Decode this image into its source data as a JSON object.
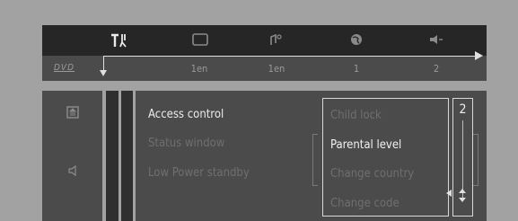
{
  "top_icons": [
    {
      "name": "settings-tools-icon",
      "active": true
    },
    {
      "name": "picture-icon",
      "active": false
    },
    {
      "name": "audio-icon",
      "active": false
    },
    {
      "name": "language-icon",
      "active": false
    },
    {
      "name": "speaker-icon",
      "active": false
    }
  ],
  "info_bar": {
    "disc_label": "DVD",
    "values": [
      "1en",
      "1en",
      "1",
      "2"
    ]
  },
  "side_icons": [
    "disc-icon",
    "speaker-icon"
  ],
  "main_menu": {
    "items": [
      {
        "label": "Access control",
        "active": true
      },
      {
        "label": "Status window",
        "active": false
      },
      {
        "label": "Low Power standby",
        "active": false
      }
    ]
  },
  "submenu": {
    "items": [
      {
        "label": "Child lock",
        "active": false
      },
      {
        "label": "Parental level",
        "active": true
      },
      {
        "label": "Change country",
        "active": false
      },
      {
        "label": "Change code",
        "active": false
      }
    ]
  },
  "value_box": {
    "value": "2"
  }
}
